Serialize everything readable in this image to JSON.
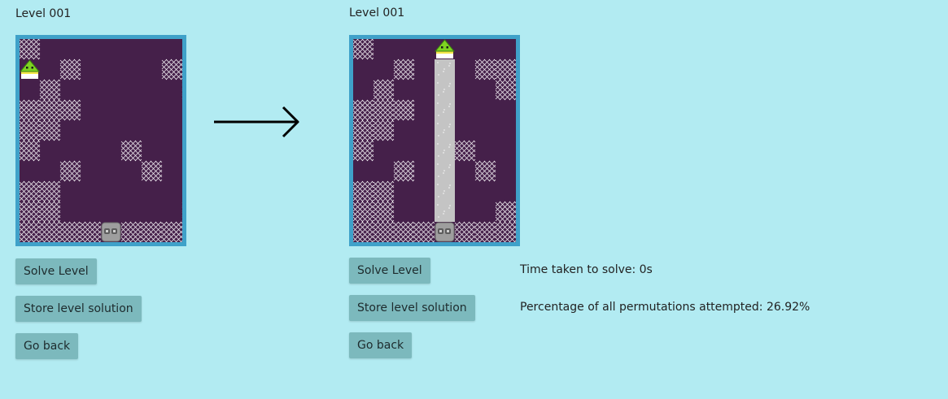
{
  "left": {
    "level_title": "Level 001",
    "buttons": {
      "solve": "Solve Level",
      "store": "Store level solution",
      "back": "Go back"
    },
    "player_pos": {
      "col": 0,
      "row": 1
    },
    "exit_pos": {
      "col": 4,
      "row": 9
    },
    "walls": [
      [
        0,
        0
      ],
      [
        2,
        1
      ],
      [
        7,
        1
      ],
      [
        8,
        1
      ],
      [
        1,
        2
      ],
      [
        8,
        2
      ],
      [
        0,
        3
      ],
      [
        1,
        3
      ],
      [
        2,
        3
      ],
      [
        0,
        4
      ],
      [
        1,
        4
      ],
      [
        0,
        5
      ],
      [
        5,
        5
      ],
      [
        2,
        6
      ],
      [
        6,
        6
      ],
      [
        0,
        7
      ],
      [
        1,
        7
      ],
      [
        0,
        8
      ],
      [
        1,
        8
      ],
      [
        8,
        8
      ],
      [
        0,
        9
      ],
      [
        1,
        9
      ],
      [
        2,
        9
      ],
      [
        3,
        9
      ],
      [
        5,
        9
      ],
      [
        6,
        9
      ],
      [
        7,
        9
      ],
      [
        8,
        9
      ]
    ],
    "path": []
  },
  "right": {
    "level_title": "Level 001",
    "buttons": {
      "solve": "Solve Level",
      "store": "Store level solution",
      "back": "Go back"
    },
    "player_pos": {
      "col": 4,
      "row": 0
    },
    "exit_pos": {
      "col": 4,
      "row": 9
    },
    "walls": [
      [
        0,
        0
      ],
      [
        2,
        1
      ],
      [
        6,
        1
      ],
      [
        7,
        1
      ],
      [
        1,
        2
      ],
      [
        7,
        2
      ],
      [
        0,
        3
      ],
      [
        1,
        3
      ],
      [
        2,
        3
      ],
      [
        0,
        4
      ],
      [
        1,
        4
      ],
      [
        0,
        5
      ],
      [
        5,
        5
      ],
      [
        2,
        6
      ],
      [
        6,
        6
      ],
      [
        0,
        7
      ],
      [
        1,
        7
      ],
      [
        0,
        8
      ],
      [
        1,
        8
      ],
      [
        7,
        8
      ],
      [
        0,
        9
      ],
      [
        1,
        9
      ],
      [
        2,
        9
      ],
      [
        3,
        9
      ],
      [
        5,
        9
      ],
      [
        6,
        9
      ],
      [
        7,
        9
      ]
    ],
    "path": [
      [
        4,
        1
      ],
      [
        4,
        2
      ],
      [
        4,
        3
      ],
      [
        4,
        4
      ],
      [
        4,
        5
      ],
      [
        4,
        6
      ],
      [
        4,
        7
      ],
      [
        4,
        8
      ]
    ]
  },
  "stats": {
    "time_label": "Time taken to solve: 0s",
    "permutations_label": "Percentage of all permutations attempted: 26.92%"
  },
  "icons": {
    "transition": "arrow-right-icon",
    "player": "player-icon",
    "exit": "exit-icon",
    "wall": "wall-tile"
  },
  "colors": {
    "background": "#b2ebf2",
    "board_border": "#3fa1c9",
    "board_fill": "#45204a",
    "path": "#c4c4c4",
    "button": "#7cb9bd",
    "player": "#7ed321"
  }
}
